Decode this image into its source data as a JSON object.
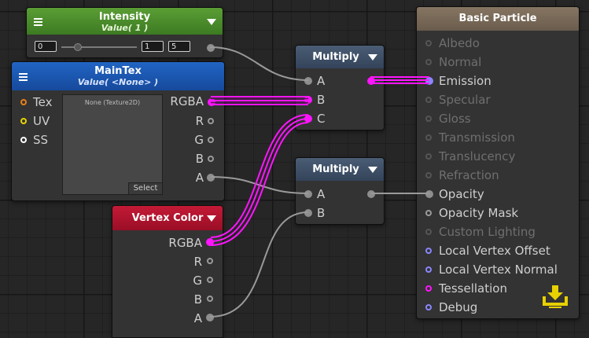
{
  "colors": {
    "magenta_wire": "#ff14ff",
    "grey_wire": "#9a9a9a",
    "intensity_header": "#4a8a2c",
    "maintex_header": "#1c56b0",
    "vertexcolor_header": "#b01030",
    "multiply_header": "#3d4e62",
    "basic_header": "#7a6a58",
    "uv_port": "#e5d500",
    "tex_port": "#e87f1a",
    "lighting_port": "#8a86ff",
    "tessellation_port": "#ff14ff",
    "download_icon": "#e8d100"
  },
  "nodes": {
    "intensity": {
      "title": "Intensity",
      "subtitle": "Value( 1 )",
      "fields": {
        "min": "0",
        "value": "1",
        "max": "5"
      }
    },
    "maintex": {
      "title": "MainTex",
      "subtitle": "Value( <None> )",
      "inputs": [
        "Tex",
        "UV",
        "SS"
      ],
      "outputs": [
        "RGBA",
        "R",
        "G",
        "B",
        "A"
      ],
      "texture_name": "None (Texture2D)",
      "select_label": "Select"
    },
    "vertex_color": {
      "title": "Vertex Color",
      "outputs": [
        "RGBA",
        "R",
        "G",
        "B",
        "A"
      ]
    },
    "multiply1": {
      "title": "Multiply",
      "inputs": [
        "A",
        "B",
        "C"
      ]
    },
    "multiply2": {
      "title": "Multiply",
      "inputs": [
        "A",
        "B"
      ]
    },
    "basic_particle": {
      "title": "Basic Particle",
      "inputs": [
        {
          "label": "Albedo",
          "state": "disabled"
        },
        {
          "label": "Normal",
          "state": "disabled"
        },
        {
          "label": "Emission",
          "state": "connected"
        },
        {
          "label": "Specular",
          "state": "disabled"
        },
        {
          "label": "Gloss",
          "state": "disabled"
        },
        {
          "label": "Transmission",
          "state": "disabled"
        },
        {
          "label": "Translucency",
          "state": "disabled"
        },
        {
          "label": "Refraction",
          "state": "disabled"
        },
        {
          "label": "Opacity",
          "state": "connected"
        },
        {
          "label": "Opacity Mask",
          "state": "enabled"
        },
        {
          "label": "Custom Lighting",
          "state": "disabled"
        },
        {
          "label": "Local Vertex Offset",
          "state": "enabled"
        },
        {
          "label": "Local Vertex Normal",
          "state": "enabled"
        },
        {
          "label": "Tessellation",
          "state": "enabled"
        },
        {
          "label": "Debug",
          "state": "enabled"
        }
      ],
      "icon": "download-icon"
    }
  }
}
